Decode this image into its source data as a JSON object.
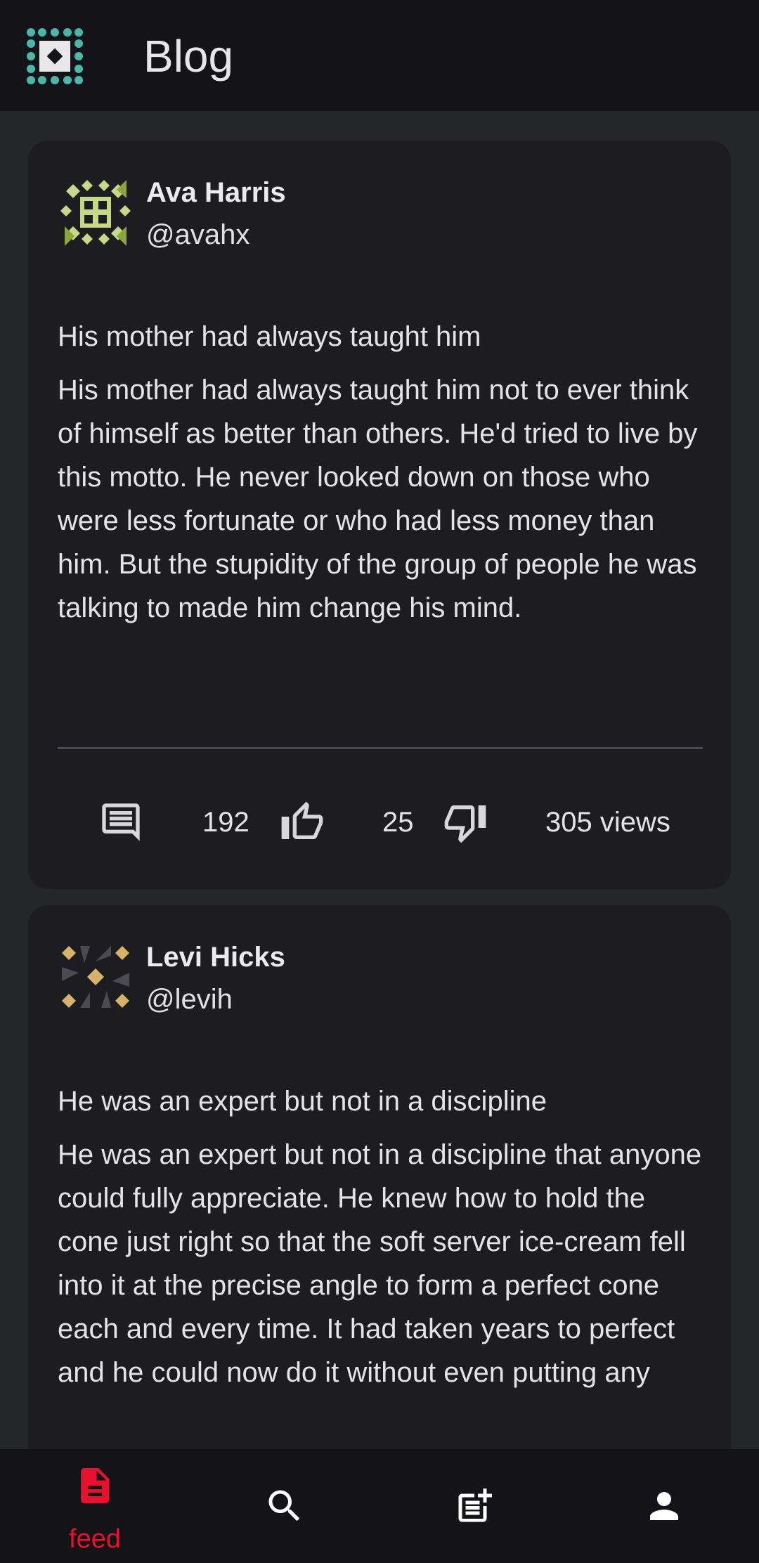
{
  "header": {
    "title": "Blog",
    "logo_icon": "app-logo-icon"
  },
  "posts": [
    {
      "author_name": "Ava Harris",
      "author_handle": "@avahx",
      "title": "His mother had always taught him",
      "body": "His mother had always taught him not to ever think of himself as better than others. He'd tried to live by this motto. He never looked down on those who were less fortunate or who had less money than him. But the stupidity of the group of people he was talking to made him change his mind.",
      "likes": "192",
      "dislikes": "25",
      "views": "305 views"
    },
    {
      "author_name": "Levi Hicks",
      "author_handle": "@levih",
      "title": "He was an expert but not in a discipline",
      "body": "He was an expert but not in a discipline that anyone could fully appreciate. He knew how to hold the cone just right so that the soft server ice-cream fell into it at the precise angle to form a perfect cone each and every time. It had taken years to perfect and he could now do it without even putting any"
    }
  ],
  "nav": {
    "items": [
      {
        "label": "feed",
        "icon": "feed-icon",
        "active": true
      },
      {
        "label": "",
        "icon": "search-icon"
      },
      {
        "label": "",
        "icon": "new-post-icon"
      },
      {
        "label": "",
        "icon": "profile-icon"
      }
    ]
  },
  "colors": {
    "background": "#24262a",
    "card": "#1d1c21",
    "bar": "#141318",
    "accent": "#e8112d"
  }
}
